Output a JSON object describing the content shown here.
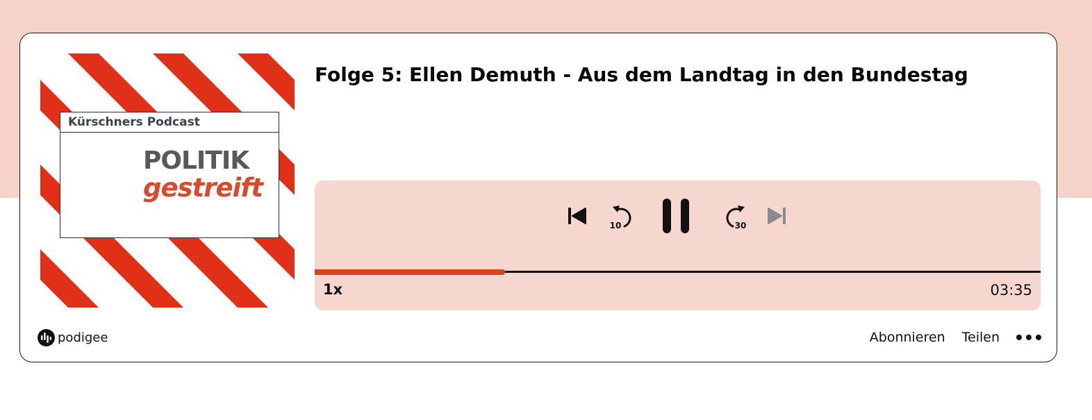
{
  "episode": {
    "title": "Folge 5: Ellen Demuth - Aus dem Landtag in den Bundestag"
  },
  "cover": {
    "header": "Kürschners Podcast",
    "word1": "POLITIK",
    "word2": "gestreift",
    "stripe_color": "#e03018",
    "word2_color": "#d94a2b"
  },
  "player": {
    "speed": "1x",
    "duration": "03:35",
    "progress_fraction": 0.262,
    "skip_back_seconds": "10",
    "skip_forward_seconds": "30",
    "state": "playing",
    "accent_color": "#d9431e",
    "panel_color": "#f6d7d0",
    "icons": {
      "previous": "skip-previous-icon",
      "back": "rewind-10-icon",
      "pause": "pause-icon",
      "forward": "forward-30-icon",
      "next": "skip-next-icon"
    }
  },
  "footer": {
    "brand": "podigee",
    "subscribe": "Abonnieren",
    "share": "Teilen",
    "more_icon": "more-dots-icon"
  },
  "page": {
    "band_color": "#f6d3c9"
  }
}
